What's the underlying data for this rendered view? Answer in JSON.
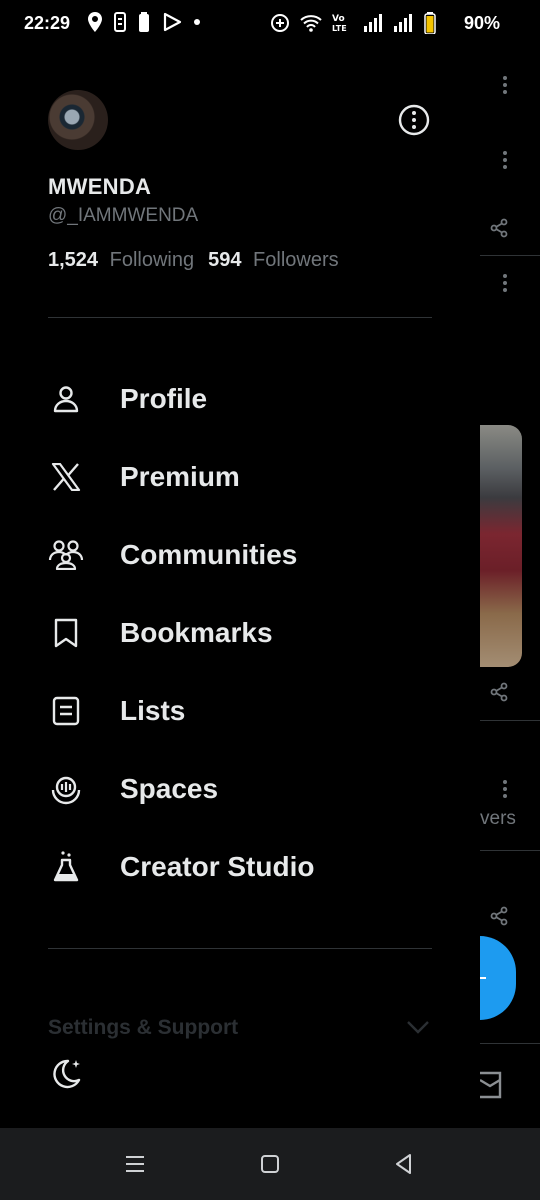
{
  "status_bar": {
    "time": "22:29",
    "battery_percent": "90%",
    "left_icons": [
      "location-icon",
      "sim-icon",
      "battery-saver-icon",
      "play-icon",
      "dot-icon"
    ],
    "right_icons": [
      "data-saver-icon",
      "wifi-icon",
      "volte-icon",
      "signal-icon",
      "signal-icon",
      "battery-icon"
    ]
  },
  "profile": {
    "display_name": "MWENDA",
    "handle": "@_IAMMWENDA",
    "following_count": "1,524",
    "following_label": "Following",
    "followers_count": "594",
    "followers_label": "Followers"
  },
  "menu": {
    "items": [
      {
        "label": "Profile",
        "icon": "person-icon"
      },
      {
        "label": "Premium",
        "icon": "x-logo-icon"
      },
      {
        "label": "Communities",
        "icon": "communities-icon"
      },
      {
        "label": "Bookmarks",
        "icon": "bookmark-icon"
      },
      {
        "label": "Lists",
        "icon": "list-icon"
      },
      {
        "label": "Spaces",
        "icon": "spaces-icon"
      },
      {
        "label": "Creator Studio",
        "icon": "flask-icon"
      }
    ]
  },
  "settings": {
    "label": "Settings & Support"
  },
  "peek": {
    "partial_text": "vers"
  },
  "colors": {
    "background": "#000000",
    "primary_text": "#e7e9ea",
    "secondary_text": "#71767b",
    "divider": "#2f3336",
    "accent": "#1d9bf0"
  }
}
